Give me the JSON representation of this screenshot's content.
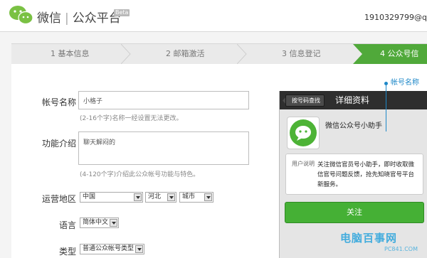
{
  "header": {
    "brand_wechat": "微信",
    "brand_platform": "公众平台",
    "beta": "Beta",
    "account": "1910329799@q"
  },
  "steps": [
    {
      "label": "1 基本信息"
    },
    {
      "label": "2 邮箱激活"
    },
    {
      "label": "3 信息登记"
    },
    {
      "label": "4 公众号信"
    }
  ],
  "form": {
    "account_name_label": "帐号名称",
    "account_name_value": "小格子",
    "account_name_hint": "(2-16个字)名称一经设置无法更改。",
    "intro_label": "功能介绍",
    "intro_value": "聊天解闷的",
    "intro_hint": "(4-120个字)介绍此公众帐号功能与特色。",
    "region_label": "运营地区",
    "country": "中国",
    "province": "河北",
    "city": "城市",
    "language_label": "语言",
    "language": "简体中文",
    "type_label": "类型",
    "type": "普通公众帐号类型"
  },
  "preview": {
    "annotation": "帐号名称",
    "back_button": "按号码查找",
    "title": "详细资料",
    "name": "微信公众号小助手",
    "desc_label": "用户说明",
    "desc_text": "关注微信官员号小助手，即时收取微信官号问题反馈，抢先知晓官号平台新服务。",
    "follow_button": "关注"
  },
  "watermark": {
    "text": "电脑百事网",
    "url": "PC841.COM"
  },
  "colors": {
    "active_step": "#50a93a",
    "follow_button": "#45b035",
    "annotation": "#1e88c8"
  }
}
